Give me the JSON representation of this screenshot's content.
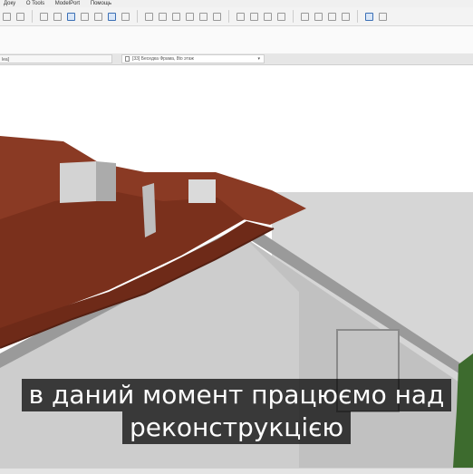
{
  "menu": {
    "items": [
      "Доку",
      "O Tools",
      "ModelPort",
      "Помощь"
    ]
  },
  "tabs": {
    "left_tab": {
      "label": "lea]"
    },
    "view_tab": {
      "label": "[33] Беседка Фрама, 8to этаж"
    }
  },
  "subtitle": {
    "line1": "в даний момент працюємо над",
    "line2": "реконструкцією"
  },
  "colors": {
    "roof": "#8a3a24",
    "wall": "#cfcfcf",
    "wall_shadow": "#9e9e9e",
    "subtitle_bg": "#000000",
    "subtitle_text": "#ffffff"
  }
}
